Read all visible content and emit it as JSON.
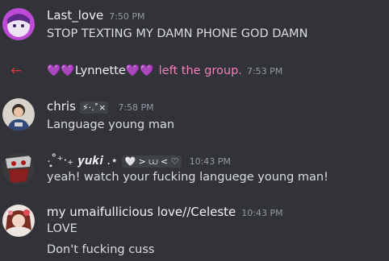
{
  "messages": [
    {
      "username": "Last_love",
      "timestamp": "7:50 PM",
      "lines": [
        "STOP TEXTING MY DAMN PHONE GOD DAMN"
      ]
    },
    {
      "username": "chris",
      "badge": "⚡·.˚×",
      "timestamp": "7:58 PM",
      "lines": [
        "Language young man"
      ]
    },
    {
      "username": "·͙̥˚⁺‧₊ 𝒚𝒖𝒌𝒊 .⋆",
      "badge": "🤍 > ⩊ < ♡",
      "timestamp": "10:43 PM",
      "lines": [
        "yeah! watch your fucking languege young man!"
      ]
    },
    {
      "username": "my umaifullicious love//Celeste",
      "timestamp": "10:43 PM",
      "lines": [
        "LOVE",
        "Don't fucking cuss"
      ]
    }
  ],
  "system_message": {
    "hearts_before": "💜💜",
    "name": "Lynnette",
    "hearts_after": "💜💜",
    "action": "left the group.",
    "timestamp": "7:53 PM",
    "arrow": "←"
  },
  "colors": {
    "background": "#313338",
    "username": "#f2f3f5",
    "timestamp": "#949ba4",
    "body_text": "#dbdee1",
    "leave_arrow": "#da373c",
    "leave_action": "#f47fbd",
    "heart": "#8b5cf6"
  },
  "icons": {
    "leave": "arrow-left-icon",
    "heart": "purple-heart-icon"
  }
}
